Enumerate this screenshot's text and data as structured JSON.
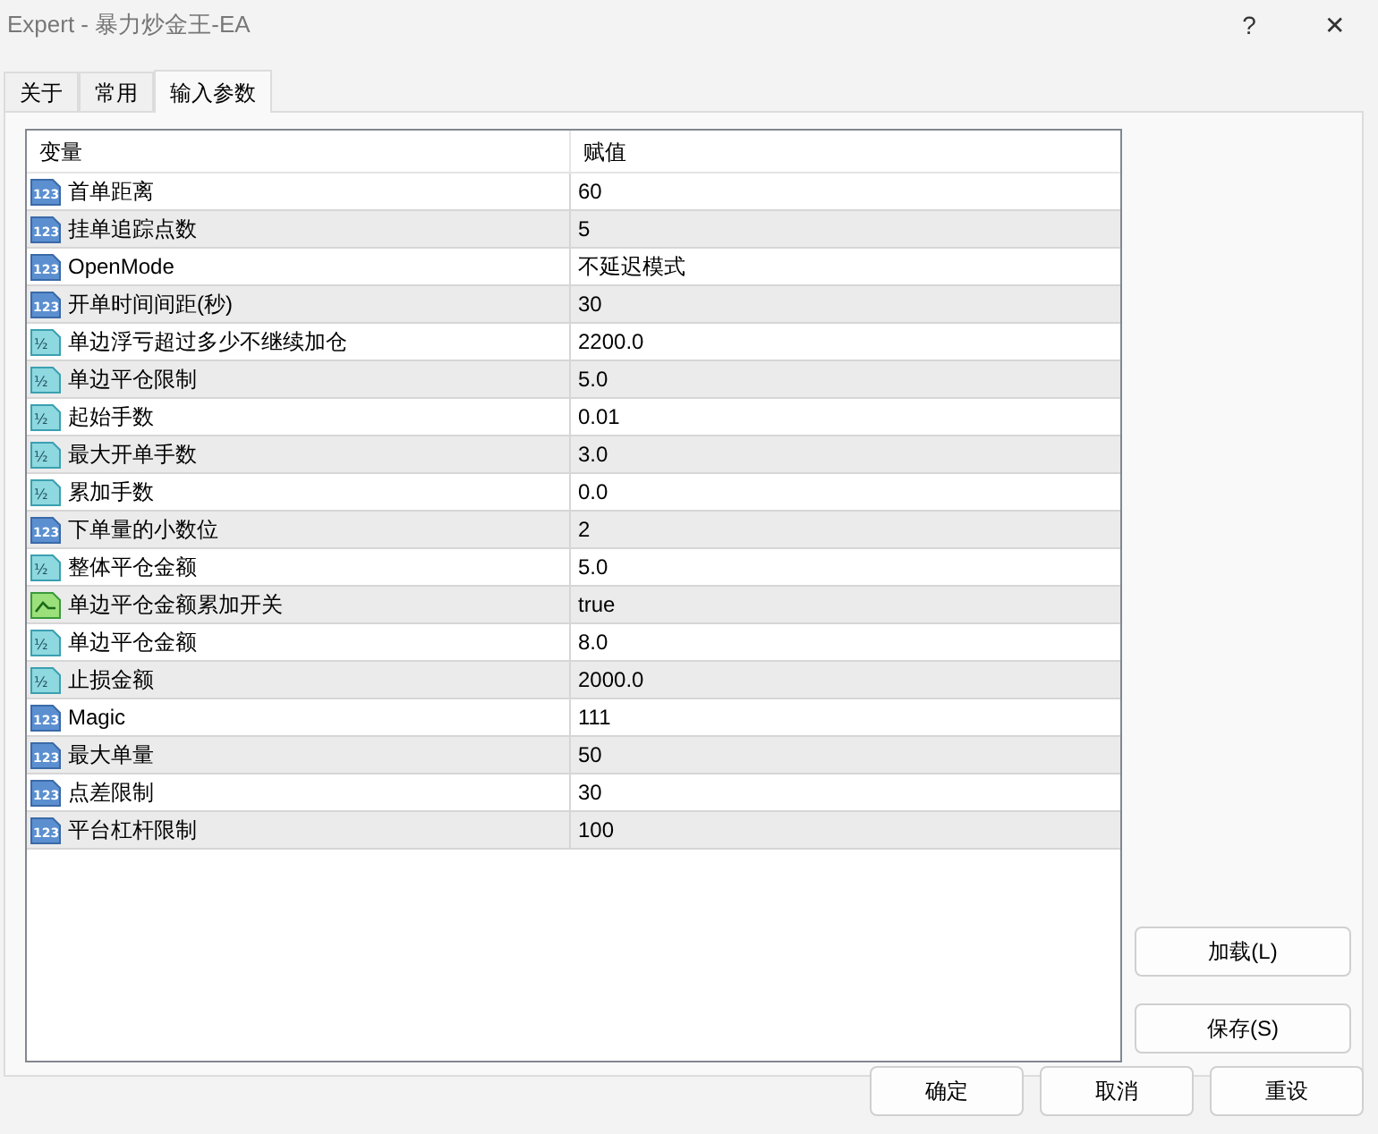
{
  "window": {
    "title": "Expert - 暴力炒金王-EA",
    "help": "?",
    "close": "✕"
  },
  "tabs": [
    {
      "label": "关于",
      "selected": false
    },
    {
      "label": "常用",
      "selected": false
    },
    {
      "label": "输入参数",
      "selected": true
    }
  ],
  "table": {
    "columns": [
      "变量",
      "赋值"
    ],
    "rows": [
      {
        "kind": "int",
        "badge": "123",
        "name": "首单距离",
        "value": "60"
      },
      {
        "kind": "int",
        "badge": "123",
        "name": "挂单追踪点数",
        "value": "5"
      },
      {
        "kind": "int",
        "badge": "123",
        "name": "OpenMode",
        "value": "不延迟模式"
      },
      {
        "kind": "int",
        "badge": "123",
        "name": "开单时间间距(秒)",
        "value": "30"
      },
      {
        "kind": "double",
        "badge": "½",
        "name": "单边浮亏超过多少不继续加仓",
        "value": "2200.0"
      },
      {
        "kind": "double",
        "badge": "½",
        "name": "单边平仓限制",
        "value": "5.0"
      },
      {
        "kind": "double",
        "badge": "½",
        "name": "起始手数",
        "value": "0.01"
      },
      {
        "kind": "double",
        "badge": "½",
        "name": "最大开单手数",
        "value": "3.0"
      },
      {
        "kind": "double",
        "badge": "½",
        "name": "累加手数",
        "value": "0.0"
      },
      {
        "kind": "int",
        "badge": "123",
        "name": "下单量的小数位",
        "value": "2"
      },
      {
        "kind": "double",
        "badge": "½",
        "name": "整体平仓金额",
        "value": "5.0"
      },
      {
        "kind": "bool",
        "name": "单边平仓金额累加开关",
        "value": "true"
      },
      {
        "kind": "double",
        "badge": "½",
        "name": "单边平仓金额",
        "value": "8.0"
      },
      {
        "kind": "double",
        "badge": "½",
        "name": "止损金额",
        "value": "2000.0"
      },
      {
        "kind": "int",
        "badge": "123",
        "name": "Magic",
        "value": "111"
      },
      {
        "kind": "int",
        "badge": "123",
        "name": "最大单量",
        "value": "50"
      },
      {
        "kind": "int",
        "badge": "123",
        "name": "点差限制",
        "value": "30"
      },
      {
        "kind": "int",
        "badge": "123",
        "name": "平台杠杆限制",
        "value": "100"
      }
    ]
  },
  "side_buttons": [
    "加载(L)",
    "保存(S)"
  ],
  "bottom_buttons": [
    "确定",
    "取消",
    "重设"
  ]
}
